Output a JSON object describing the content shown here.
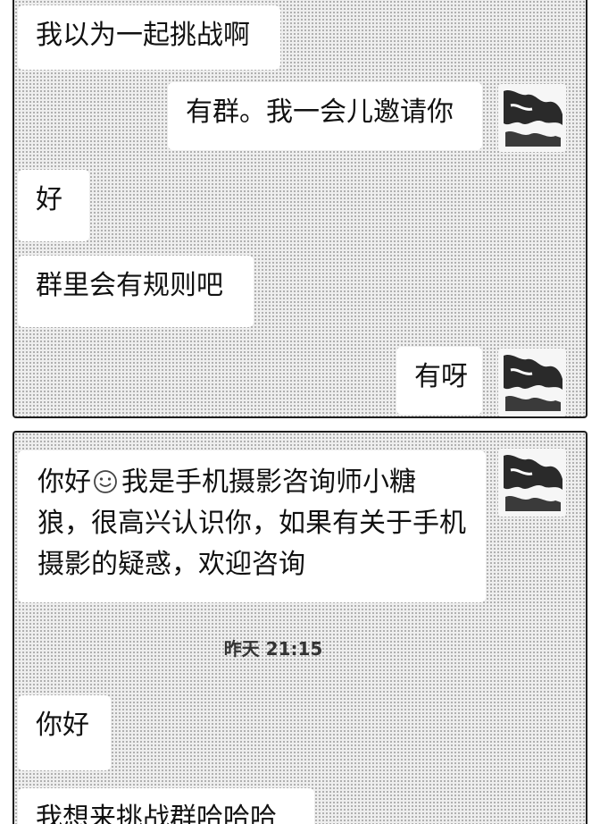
{
  "panel_1": {
    "messages": [
      {
        "side": "left",
        "text": "我以为一起挑战啊"
      },
      {
        "side": "right",
        "text": "有群。我一会儿邀请你"
      },
      {
        "side": "left",
        "text": "好"
      },
      {
        "side": "left",
        "text": "群里会有规则吧"
      },
      {
        "side": "right",
        "text": "有呀"
      }
    ]
  },
  "panel_2": {
    "greeting": {
      "side": "right",
      "text_before_emoji": "你好",
      "emoji": "smile-icon",
      "text_after_emoji": "我是手机摄影咨询师小糖狼，很高兴认识你，如果有关于手机摄影的疑惑，欢迎咨询"
    },
    "timestamp": "昨天 21:15",
    "messages": [
      {
        "side": "left",
        "text": "你好"
      },
      {
        "side": "left",
        "text": "我想来挑战群哈哈哈"
      }
    ]
  },
  "colors": {
    "bubble": "#ffffff",
    "background": "#eeeeee",
    "text": "#111111",
    "border": "#1e1e1e"
  }
}
